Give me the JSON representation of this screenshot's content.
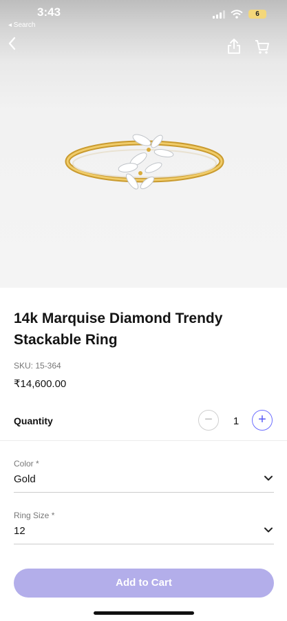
{
  "status_bar": {
    "time": "3:43",
    "back_label": "◂ Search",
    "battery": "6"
  },
  "product": {
    "title": "14k Marquise Diamond Trendy Stackable Ring",
    "sku": "SKU: 15-364",
    "price": "₹14,600.00",
    "image": "gold-ring-with-marquise-diamonds"
  },
  "quantity": {
    "label": "Quantity",
    "value": "1",
    "minus": "−",
    "plus": "+"
  },
  "fields": {
    "color": {
      "label": "Color *",
      "value": "Gold"
    },
    "ring_size": {
      "label": "Ring Size *",
      "value": "12"
    }
  },
  "actions": {
    "add_to_cart": "Add to Cart"
  },
  "colors": {
    "accent": "#5557f5",
    "button": "#b3aeea",
    "gold": "#d9ab3a"
  },
  "icons": [
    "back-icon",
    "share-icon",
    "cart-icon",
    "chevron-down-icon",
    "wifi-icon",
    "signal-icon",
    "battery-icon"
  ]
}
